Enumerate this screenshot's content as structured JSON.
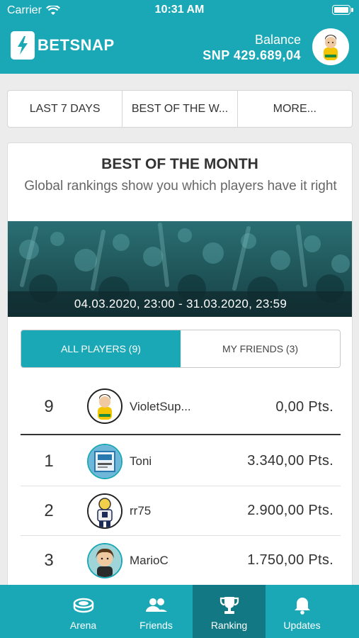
{
  "status_bar": {
    "carrier": "Carrier",
    "time": "10:31 AM"
  },
  "header": {
    "logo_text": "BETSNAP",
    "balance_label": "Balance",
    "balance_value": "SNP 429.689,04"
  },
  "filters": [
    {
      "label": "LAST 7 DAYS"
    },
    {
      "label": "BEST OF THE W..."
    },
    {
      "label": "MORE..."
    }
  ],
  "card": {
    "title": "BEST OF THE MONTH",
    "subtitle": "Global rankings show you which players have it right",
    "date_range": "04.03.2020, 23:00 - 31.03.2020, 23:59"
  },
  "tabs": [
    {
      "label": "ALL PLAYERS (9)",
      "active": true
    },
    {
      "label": "MY FRIENDS (3)",
      "active": false
    }
  ],
  "current_user_row": {
    "rank": "9",
    "name": "VioletSup...",
    "points": "0,00 Pts."
  },
  "rankings": [
    {
      "rank": "1",
      "name": "Toni",
      "points": "3.340,00 Pts."
    },
    {
      "rank": "2",
      "name": "rr75",
      "points": "2.900,00 Pts."
    },
    {
      "rank": "3",
      "name": "MarioC",
      "points": "1.750,00 Pts."
    }
  ],
  "tabbar": [
    {
      "label": "Arena",
      "icon": "stadium-icon"
    },
    {
      "label": "Friends",
      "icon": "friends-icon"
    },
    {
      "label": "Ranking",
      "icon": "trophy-icon",
      "active": true
    },
    {
      "label": "Updates",
      "icon": "bell-icon"
    }
  ],
  "colors": {
    "brand": "#1ba8b6",
    "brand_dark": "#127984"
  }
}
